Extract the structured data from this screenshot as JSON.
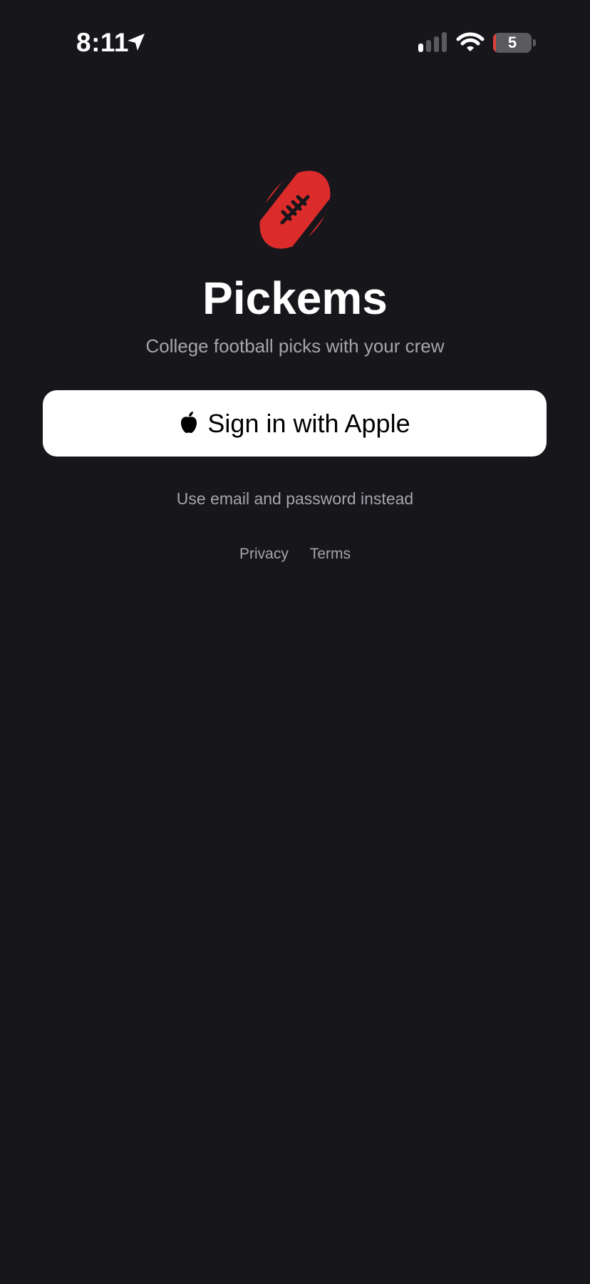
{
  "status_bar": {
    "time": "8:11",
    "battery_level": "5",
    "icons": [
      "location-arrow-icon",
      "cellular-signal-icon",
      "wifi-icon",
      "battery-icon"
    ]
  },
  "app": {
    "logo_icon": "football-icon",
    "title": "Pickems",
    "tagline": "College football picks with your crew"
  },
  "auth": {
    "apple_button_label": "Sign in with Apple",
    "apple_icon": "apple-logo-icon",
    "email_link_label": "Use email and password instead"
  },
  "footer": {
    "privacy_label": "Privacy",
    "terms_label": "Terms"
  },
  "colors": {
    "background": "#17161b",
    "accent_red": "#db2b2b",
    "muted_text": "#a6a5ab",
    "button_bg": "#ffffff"
  }
}
